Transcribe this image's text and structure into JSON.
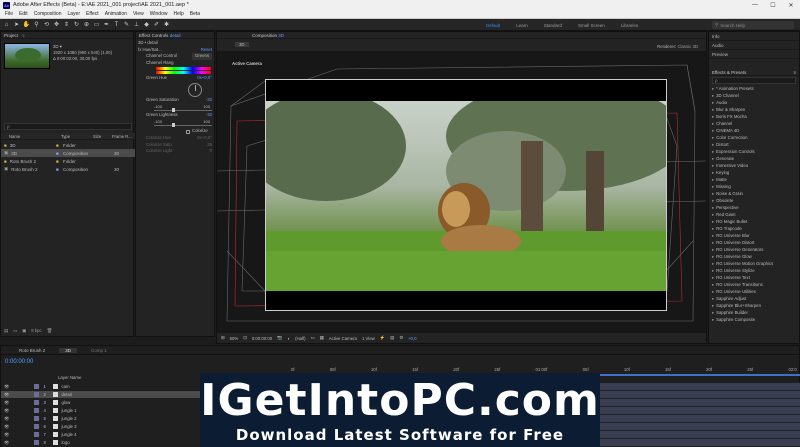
{
  "window": {
    "title": "Adobe After Effects (Beta) - E:\\AE 2021_001 project\\AE 2021_001.aep *",
    "app_badge": "Ae",
    "minimize": "—",
    "maximize": "☐",
    "close": "✕"
  },
  "menu": [
    "File",
    "Edit",
    "Composition",
    "Layer",
    "Effect",
    "Animation",
    "View",
    "Window",
    "Help",
    "Beta"
  ],
  "workspaces": [
    "Default",
    "Learn",
    "Standard",
    "Small Screen",
    "Libraries"
  ],
  "search_help": "Search Help",
  "project": {
    "title": "Project",
    "item_name": "3D ▾",
    "item_info1": "1920 x 1080 (960 x 540) (1,00)",
    "item_info2": "Δ 0:00:02:00, 30,00 fps",
    "search_placeholder": "ρ",
    "columns": [
      "Name",
      "Type",
      "Size",
      "Frame R..."
    ],
    "items": [
      {
        "name": "3D",
        "type": "Folder",
        "fr": ""
      },
      {
        "name": "3D",
        "type": "Composition",
        "fr": "30"
      },
      {
        "name": "Roto Brush 2",
        "type": "Folder",
        "fr": ""
      },
      {
        "name": "Roto Brush 2",
        "type": "Composition",
        "fr": "30"
      }
    ],
    "bpc": "8 bpc"
  },
  "effect_controls": {
    "title": "Effect Controls",
    "layer": "detail",
    "header": "3D • detail",
    "effect_name": "Hue/Sat...",
    "reset": "Reset",
    "channel_control_label": "Channel Control",
    "channel_control_value": "Greens",
    "channel_range": "Channel Rang",
    "green_hue_label": "Green Hue",
    "green_hue_value": "0x+0,0°",
    "green_sat_label": "Green Saturation",
    "green_sat_value": "-32",
    "sat_min": "-100",
    "sat_max": "100",
    "green_light_label": "Green Lightness",
    "green_light_value": "-32",
    "light_min": "-100",
    "light_max": "100",
    "colorize": "Colorize",
    "colorize_hue": "Colorize Hue",
    "colorize_sat": "Colorize Satu",
    "colorize_light": "Colorize Light",
    "colorize_hue_value": "0x+0,0°",
    "colorize_sat_value": "25",
    "colorize_light_value": "0"
  },
  "composition": {
    "title": "Composition",
    "name": "3D",
    "tab": "3D",
    "renderer_label": "Renderer:",
    "renderer_value": "Classic 3D",
    "camera_label": "Active Camera",
    "zoom": "50%",
    "timecode": "0:00:00:00",
    "resolution": "(Half)",
    "view_camera": "Active Camera",
    "views": "1 View",
    "exposure": "+0,0"
  },
  "right_panel": {
    "sections": [
      "Info",
      "Audio",
      "Preview"
    ],
    "effects_title": "Effects & Presets",
    "search_placeholder": "ρ",
    "items": [
      "* Animation Presets",
      "3D Channel",
      "Audio",
      "Blur & Sharpen",
      "Boris FX Mocha",
      "Channel",
      "CINEMA 4D",
      "Color Correction",
      "Distort",
      "Expression Controls",
      "Generate",
      "Immersive Video",
      "Keying",
      "Matte",
      "Missing",
      "Noise & Grain",
      "Obsolete",
      "Perspective",
      "Red Giant",
      "RG Magic Bullet",
      "RG Trapcode",
      "RG Universe Blur",
      "RG Universe Distort",
      "RG Universe Generators",
      "RG Universe Glow",
      "RG Universe Motion Graphics",
      "RG Universe Stylize",
      "RG Universe Text",
      "RG Universe Transitions",
      "RG Universe Utilities",
      "Sapphire Adjust",
      "Sapphire Blur+Sharpen",
      "Sapphire Builder",
      "Sapphire Composite"
    ]
  },
  "timeline": {
    "tabs": [
      "Roto Brush 2",
      "3D",
      "Comp 1"
    ],
    "timecode": "0:00:00:00",
    "layer_name_header": "Layer Name",
    "layers": [
      {
        "num": "1",
        "name": "cam"
      },
      {
        "num": "2",
        "name": "detail"
      },
      {
        "num": "3",
        "name": "glow"
      },
      {
        "num": "4",
        "name": "jungle 1"
      },
      {
        "num": "5",
        "name": "jungle 2"
      },
      {
        "num": "6",
        "name": "jungle 3"
      },
      {
        "num": "7",
        "name": "jungle 4"
      },
      {
        "num": "8",
        "name": "logo"
      }
    ],
    "ruler": [
      "0f",
      "05f",
      "10f",
      "15f",
      "20f",
      "25f",
      "01:00f",
      "05f",
      "10f",
      "15f",
      "20f",
      "25f",
      "02:0"
    ]
  },
  "banner": {
    "title": "IGetIntoPC.com",
    "subtitle": "Download Latest Software for Free"
  }
}
